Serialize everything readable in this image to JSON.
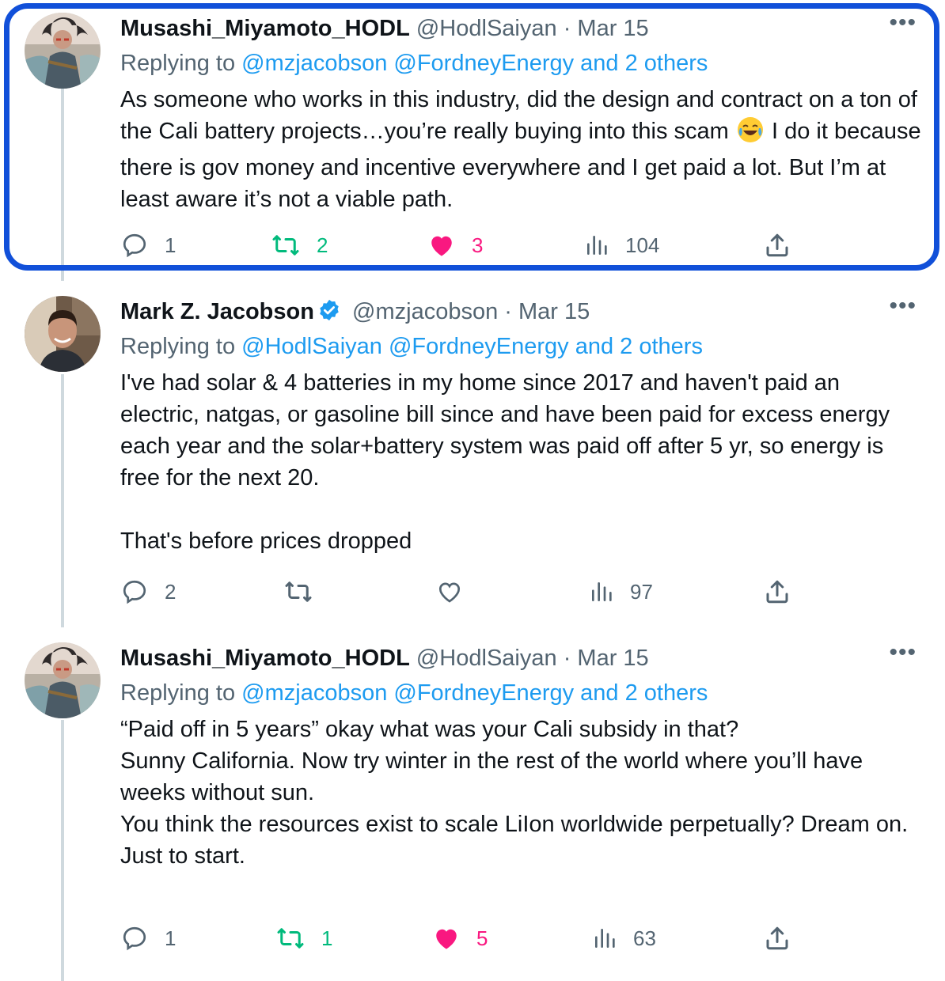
{
  "tweets": [
    {
      "name": "Musashi_Miyamoto_HODL",
      "handle": "@HodlSaiyan",
      "dot": "·",
      "date": "Mar 15",
      "replying_label": "Replying to",
      "replying_handles": "@mzjacobson @FordneyEnergy and 2 others",
      "text_part1": "As someone who works in this industry, did the design and contract on a ton of the Cali battery projects…you’re really buying into this scam",
      "emoji": "😂",
      "text_part2": "I do it because there is gov money and incentive everywhere and I get paid a lot. But I’m at least aware it’s not a viable path.",
      "replies": "1",
      "retweets": "2",
      "likes": "3",
      "views": "104",
      "retweeted": true,
      "liked": true,
      "highlighted": true
    },
    {
      "name": "Mark Z. Jacobson",
      "verified": true,
      "handle": "@mzjacobson",
      "dot": "·",
      "date": "Mar 15",
      "replying_label": "Replying to",
      "replying_handles": "@HodlSaiyan @FordneyEnergy and 2 others",
      "paragraph1": "I've had solar & 4 batteries in my home since 2017 and haven't paid an electric, natgas, or gasoline bill since and have been paid for excess energy each year and the solar+battery system was paid off after 5 yr, so energy is free for the next 20.",
      "paragraph2": "That's before prices dropped",
      "replies": "2",
      "retweets": "",
      "likes": "",
      "views": "97",
      "retweeted": false,
      "liked": false
    },
    {
      "name": "Musashi_Miyamoto_HODL",
      "handle": "@HodlSaiyan",
      "dot": "·",
      "date": "Mar 15",
      "replying_label": "Replying to",
      "replying_handles": "@mzjacobson @FordneyEnergy and 2 others",
      "line1": "“Paid off in 5 years” okay what was your Cali subsidy in that?",
      "line2": "Sunny California. Now try winter in the rest of the world where you’ll have weeks without sun.",
      "line3": "You think the resources exist to scale LiIon worldwide perpetually? Dream on.",
      "line4": "Just to start.",
      "replies": "1",
      "retweets": "1",
      "likes": "5",
      "views": "63",
      "retweeted": true,
      "liked": true
    }
  ],
  "colors": {
    "highlight_border": "#1150d9",
    "link": "#1d9bf0",
    "retweet_active": "#00ba7c",
    "like_active": "#f91880",
    "muted": "#536471"
  },
  "icons": [
    "more-icon",
    "reply-icon",
    "retweet-icon",
    "like-icon",
    "views-icon",
    "share-icon",
    "verified-icon",
    "laughing-emoji"
  ]
}
